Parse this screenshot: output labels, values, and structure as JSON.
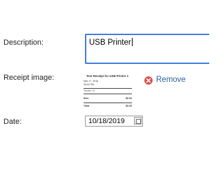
{
  "form": {
    "description_label": "Description:",
    "description_value": "USB Printer",
    "receipt_label": "Receipt image:",
    "date_label": "Date:",
    "date_value": "10/18/2019",
    "remove_label": "Remove"
  },
  "receipt": {
    "title": "Test Receipt for USB Printer 1",
    "date": "Mar 17, 2016",
    "time": "05:02 PM",
    "tender": "Tender: XI",
    "item_label": "Item",
    "item_value": "$0.00",
    "total_label": "Total",
    "total_value": "$0.00"
  },
  "icons": {
    "remove": "remove-icon",
    "calendar": "calendar-icon"
  },
  "colors": {
    "focus_border": "#3f7fd8",
    "remove_icon": "#d9534f",
    "remove_text": "#2b5f9e"
  }
}
